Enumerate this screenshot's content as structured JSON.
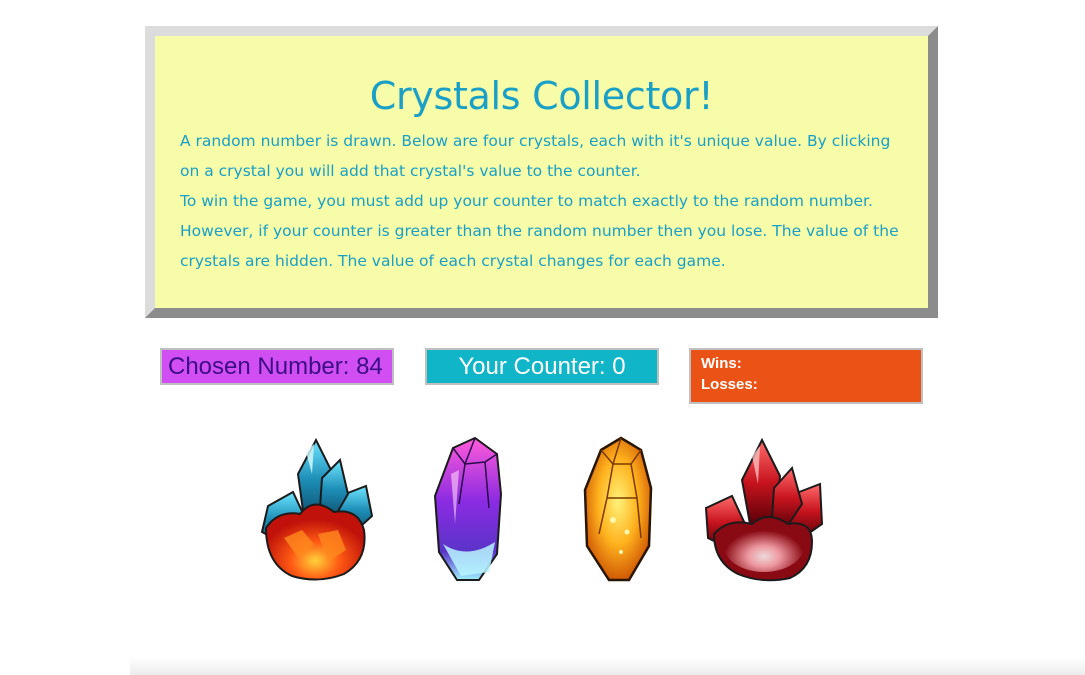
{
  "intro": {
    "title": "Crystals Collector!",
    "paragraph1": "A random number is drawn. Below are four crystals, each with it's unique value. By clicking on a crystal you will add that crystal's value to the counter.",
    "paragraph2": "To win the game, you must add up your counter to match exactly to the random number. However, if your counter is greater than the random number then you lose. The value of the crystals are hidden. The value of each crystal changes for each game."
  },
  "stats": {
    "chosen_label": "Chosen Number: 84",
    "counter_label": "Your Counter: 0",
    "wins_label": "Wins:",
    "losses_label": "Losses:"
  },
  "crystals": [
    {
      "icon": "blue-red-crystal-cluster-icon"
    },
    {
      "icon": "purple-crystal-icon"
    },
    {
      "icon": "yellow-crystal-icon"
    },
    {
      "icon": "red-crystal-cluster-icon"
    }
  ],
  "colors": {
    "panel_bg": "#f6fca8",
    "text_blue": "#1a9fc7",
    "chosen_bg": "#d14ff2",
    "counter_bg": "#10b5c7",
    "score_bg": "#eb5316"
  }
}
